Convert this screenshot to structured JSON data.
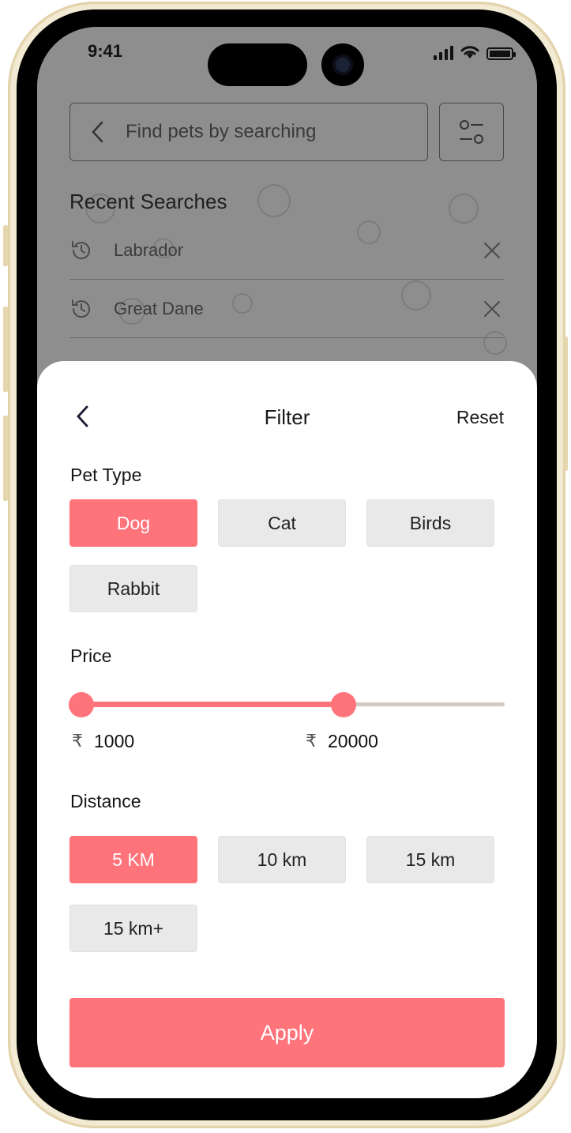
{
  "status_bar": {
    "time": "9:41"
  },
  "search": {
    "placeholder": "Find pets by searching"
  },
  "recent": {
    "title": "Recent Searches",
    "items": [
      {
        "label": "Labrador"
      },
      {
        "label": "Great Dane"
      }
    ]
  },
  "filter": {
    "title": "Filter",
    "reset_label": "Reset",
    "pet_type": {
      "label": "Pet Type",
      "options": [
        "Dog",
        "Cat",
        "Birds",
        "Rabbit"
      ],
      "selected": "Dog"
    },
    "price": {
      "label": "Price",
      "currency_symbol": "₹",
      "min_value": "1000",
      "max_value": "20000",
      "range_fraction_selected": 0.62
    },
    "distance": {
      "label": "Distance",
      "options": [
        "5 KM",
        "10 km",
        "15 km",
        "15 km+"
      ],
      "selected": "5 KM"
    },
    "apply_label": "Apply"
  },
  "colors": {
    "accent": "#ff737a",
    "chip_bg": "#e9e9e9",
    "track": "#d2c9c3"
  }
}
